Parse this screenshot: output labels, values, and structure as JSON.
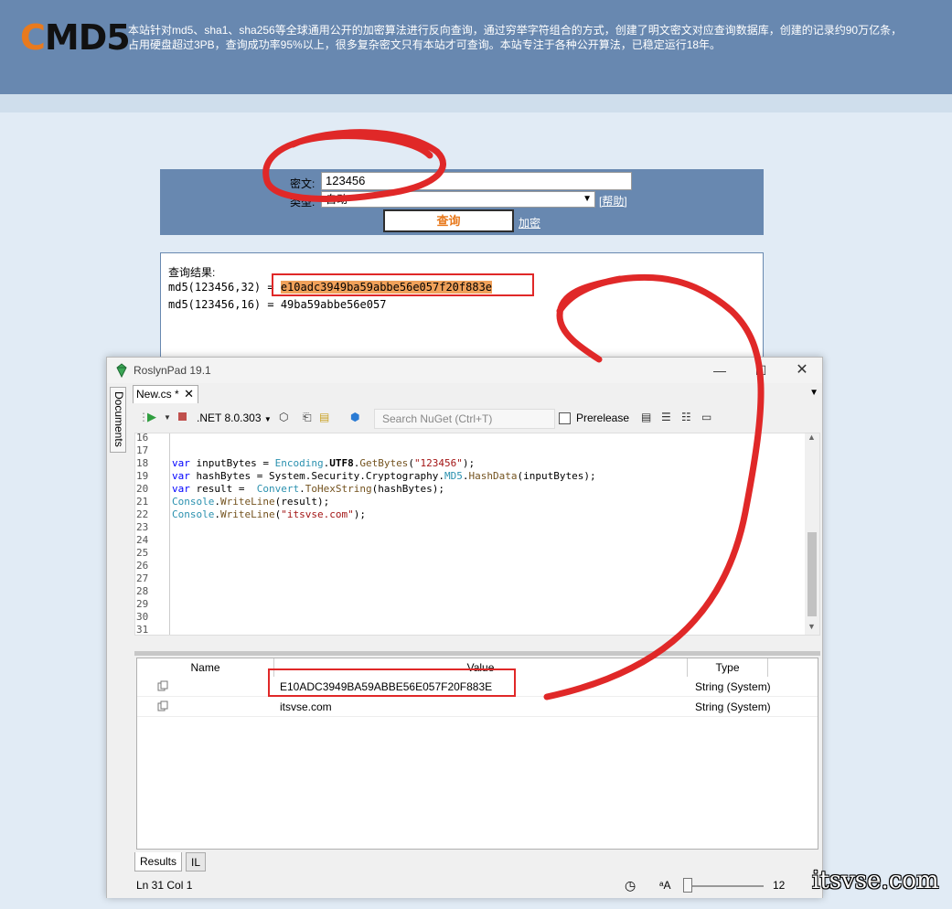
{
  "site": {
    "logo_c": "C",
    "logo_rest": "MD5",
    "intro_line1": "本站针对md5、sha1、sha256等全球通用公开的加密算法进行反向查询，通过穷举字符组合的方式，创建了明文密文对应查询数据库，创建的记录约90万亿条，",
    "intro_line2": "占用硬盘超过3PB，查询成功率95%以上，很多复杂密文只有本站才可查询。本站专注于各种公开算法，已稳定运行18年。"
  },
  "query": {
    "cipher_label": "密文:",
    "cipher_value": "123456",
    "type_label": "类型:",
    "type_value": "自动",
    "help_link": "[帮助]",
    "query_button": "查询",
    "encrypt_link": "加密"
  },
  "result": {
    "title": "查询结果:",
    "line1_prefix": "md5(123456,32) = ",
    "line1_hash": "e10adc3949ba59abbe56e057f20f883e",
    "line2": "md5(123456,16) = 49ba59abbe56e057"
  },
  "roslynpad": {
    "title": "RoslynPad 19.1",
    "side_tab": "Documents",
    "doc_tab": "New.cs *",
    "framework": ".NET 8.0.303",
    "nuget_placeholder": "Search NuGet (Ctrl+T)",
    "prerelease_label": "Prerelease",
    "line_numbers": [
      "16",
      "17",
      "18",
      "19",
      "20",
      "21",
      "22",
      "23",
      "24",
      "25",
      "26",
      "27",
      "28",
      "29",
      "30",
      "31"
    ],
    "code": {
      "l18_a": "var",
      "l18_b": " inputBytes = ",
      "l18_c": "Encoding",
      "l18_d": ".",
      "l18_e": "UTF8",
      "l18_f": ".",
      "l18_g": "GetBytes",
      "l18_h": "(",
      "l18_i": "\"123456\"",
      "l18_j": ");",
      "l19_a": "var",
      "l19_b": " hashBytes = System.Security.Cryptography.",
      "l19_c": "MD5",
      "l19_d": ".",
      "l19_e": "HashData",
      "l19_f": "(inputBytes);",
      "l20_a": "var",
      "l20_b": " result =  ",
      "l20_c": "Convert",
      "l20_d": ".",
      "l20_e": "ToHexString",
      "l20_f": "(hashBytes);",
      "l21_a": "Console",
      "l21_b": ".",
      "l21_c": "WriteLine",
      "l21_d": "(result);",
      "l22_a": "Console",
      "l22_b": ".",
      "l22_c": "WriteLine",
      "l22_d": "(",
      "l22_e": "\"itsvse.com\"",
      "l22_f": ");"
    },
    "results": {
      "headers": [
        "Name",
        "Value",
        "Type"
      ],
      "rows": [
        {
          "value": "E10ADC3949BA59ABBE56E057F20F883E",
          "type": "String (System)"
        },
        {
          "value": "itsvse.com",
          "type": "String (System)"
        }
      ]
    },
    "bottom_tabs": [
      "Results",
      "IL"
    ],
    "status": "Ln 31 Col 1",
    "zoom": "12"
  },
  "watermark": "itsvse.com",
  "colors": {
    "header_bg": "#6888b0",
    "accent_orange": "#e87a1e",
    "highlight": "#f0a15a",
    "annotation_red": "#e02828"
  }
}
